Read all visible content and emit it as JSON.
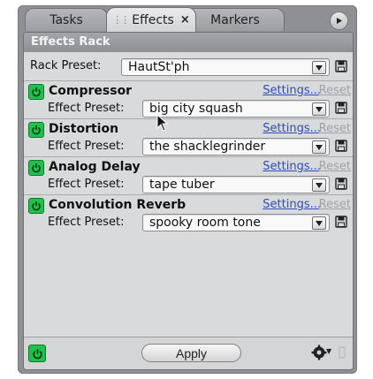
{
  "tabs": [
    {
      "label": "Tasks",
      "active": false
    },
    {
      "label": "Effects",
      "active": true,
      "close": "×"
    },
    {
      "label": "Markers",
      "active": false
    }
  ],
  "rack": {
    "title": "Effects Rack",
    "preset_label": "Rack Preset:",
    "preset_value": "HautSt'ph"
  },
  "effect_preset_label": "Effect Preset:",
  "settings_label": "Settings...",
  "reset_label": "Reset",
  "effects": [
    {
      "name": "Compressor",
      "preset": "big city squash",
      "enabled": true
    },
    {
      "name": "Distortion",
      "preset": "the shacklegrinder",
      "enabled": true
    },
    {
      "name": "Analog Delay",
      "preset": "tape tuber",
      "enabled": true
    },
    {
      "name": "Convolution Reverb",
      "preset": "spooky room tone",
      "enabled": true
    }
  ],
  "bottom": {
    "apply_label": "Apply"
  },
  "icons": {
    "power": "power-icon",
    "save": "save-preset-icon",
    "dropdown": "chevron-down-icon",
    "gear": "gear-icon",
    "menu_play": "play-menu-icon"
  },
  "colors": {
    "power_green": "#1ec24b",
    "link_blue": "#2a4fb8",
    "disabled_gray": "#a2a3a6",
    "rack_header": "#989a9e"
  }
}
